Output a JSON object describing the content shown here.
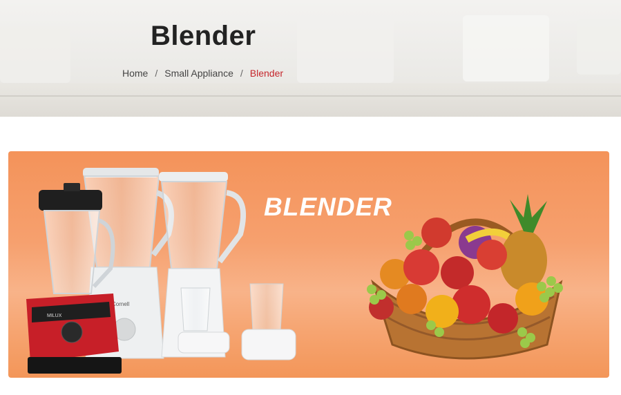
{
  "header": {
    "title": "Blender",
    "breadcrumb": [
      {
        "label": "Home"
      },
      {
        "label": "Small Appliance"
      },
      {
        "label": "Blender"
      }
    ],
    "separator": "/"
  },
  "banner": {
    "headline": "BLENDER",
    "blender_brand_white": "Cornell",
    "blender_brand_red": "MILUX",
    "background_color": "#f6a06e",
    "headline_color": "#ffffff"
  },
  "colors": {
    "breadcrumb_active": "#c5262c",
    "title": "#222222"
  }
}
